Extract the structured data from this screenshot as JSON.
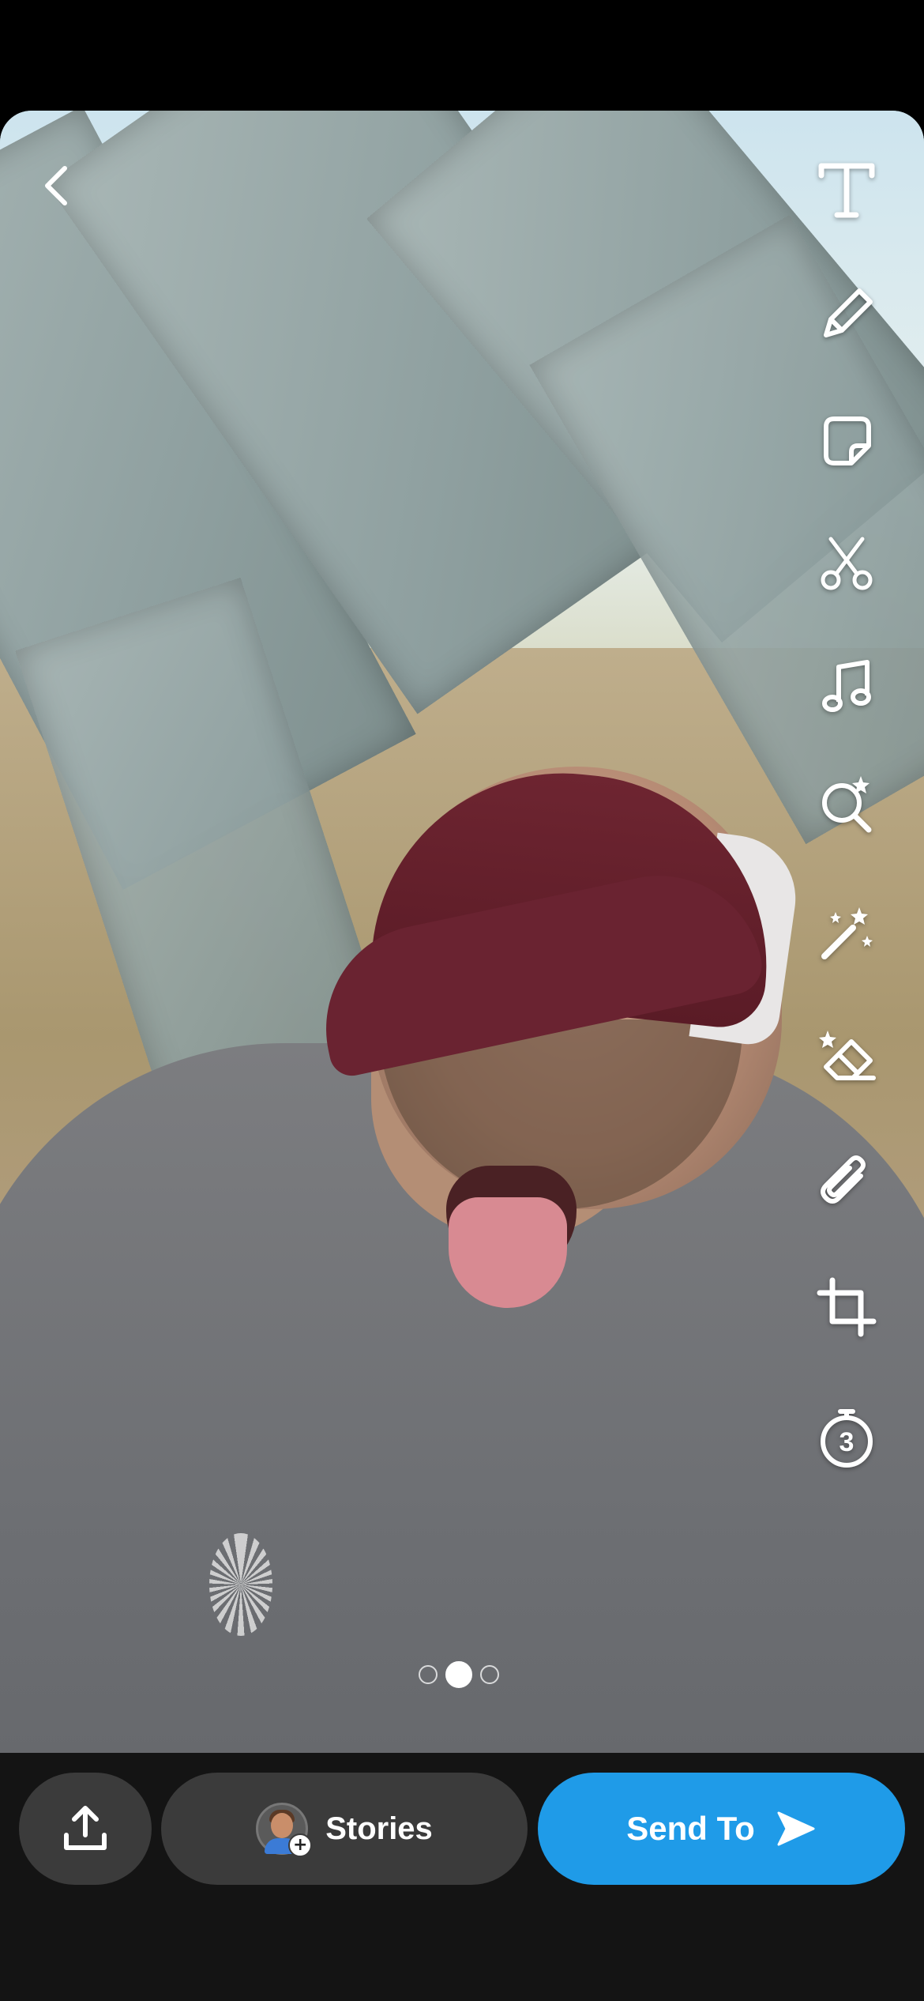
{
  "editor": {
    "back": {
      "icon": "chevron-left-icon"
    },
    "tools": [
      {
        "name": "text-tool",
        "icon": "text-t-icon"
      },
      {
        "name": "draw-tool",
        "icon": "pencil-icon"
      },
      {
        "name": "sticker-tool",
        "icon": "sticker-icon"
      },
      {
        "name": "scissors-tool",
        "icon": "scissors-icon"
      },
      {
        "name": "music-tool",
        "icon": "music-note-icon"
      },
      {
        "name": "lens-tool",
        "icon": "lens-search-icon"
      },
      {
        "name": "magic-tool",
        "icon": "magic-wand-icon"
      },
      {
        "name": "eraser-tool",
        "icon": "magic-eraser-icon"
      },
      {
        "name": "attach-tool",
        "icon": "paperclip-icon"
      },
      {
        "name": "crop-tool",
        "icon": "crop-icon"
      },
      {
        "name": "timer-tool",
        "icon": "timer-icon",
        "value": "3"
      }
    ],
    "pager": {
      "count": 3,
      "active": 1
    }
  },
  "bottom_bar": {
    "upload": {
      "icon": "upload-icon"
    },
    "stories_label": "Stories",
    "send_label": "Send To",
    "send_icon": "send-arrow-icon",
    "accent_color": "#1f9be8"
  }
}
